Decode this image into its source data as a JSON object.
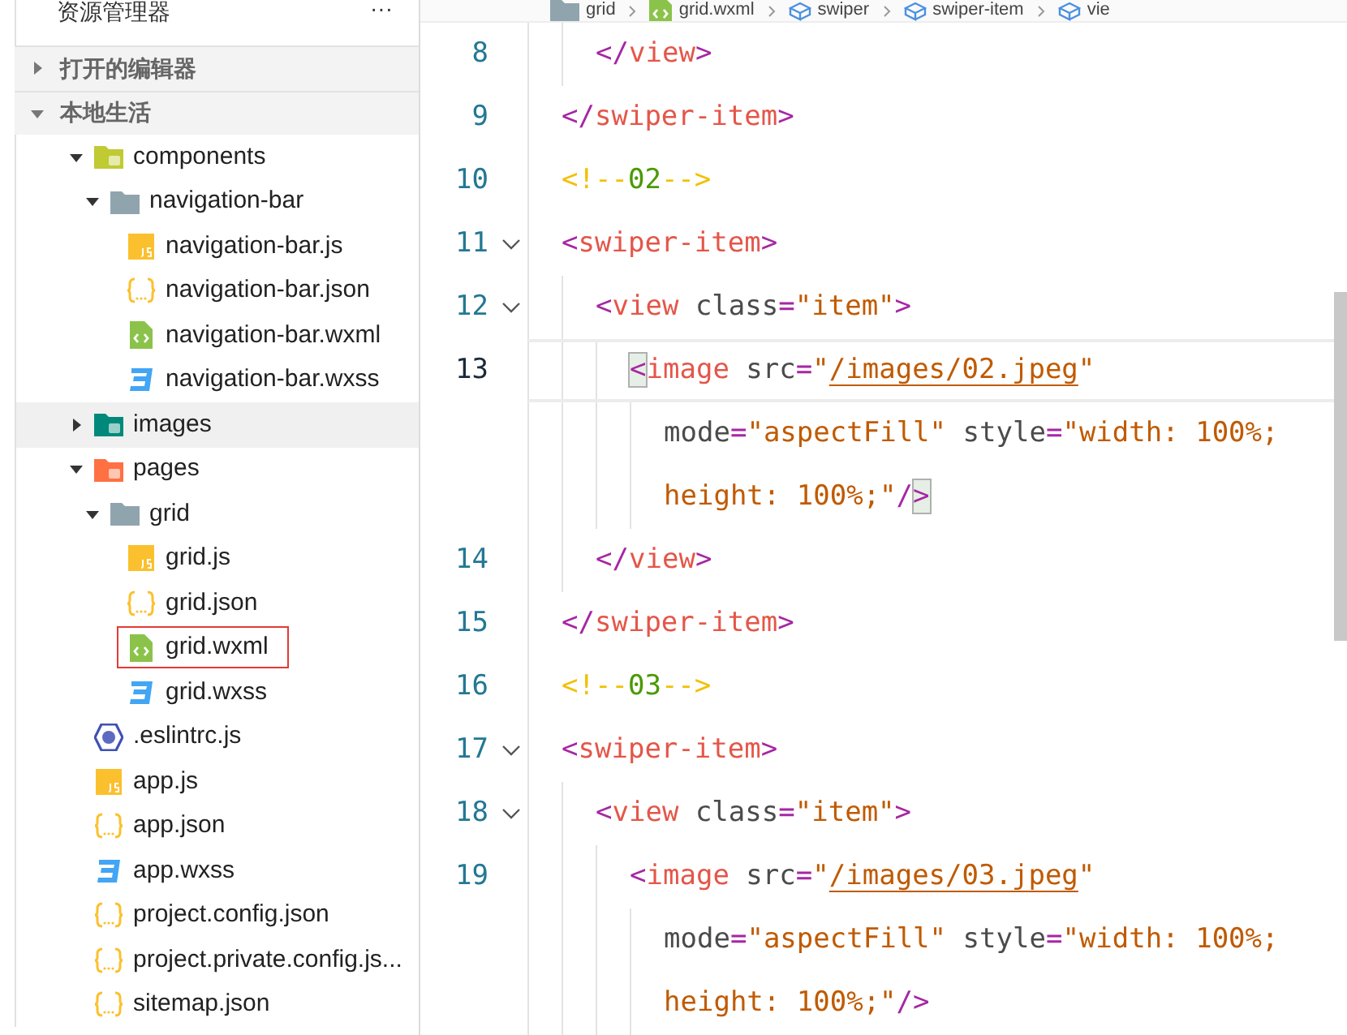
{
  "explorer": {
    "title": "资源管理器",
    "more": "···",
    "sections": [
      {
        "label": "打开的编辑器",
        "expanded": false
      },
      {
        "label": "本地生活",
        "expanded": true
      }
    ],
    "tree": [
      {
        "name": "components",
        "kind": "folder-components",
        "expanded": true,
        "outlined": false,
        "children": [
          {
            "name": "navigation-bar",
            "kind": "folder",
            "expanded": true,
            "outlined": false,
            "children": [
              {
                "name": "navigation-bar.js",
                "kind": "js",
                "outlined": false
              },
              {
                "name": "navigation-bar.json",
                "kind": "json",
                "outlined": false
              },
              {
                "name": "navigation-bar.wxml",
                "kind": "wxml",
                "outlined": false
              },
              {
                "name": "navigation-bar.wxss",
                "kind": "wxss",
                "outlined": false
              }
            ]
          }
        ]
      },
      {
        "name": "images",
        "kind": "folder-images",
        "expanded": false,
        "outlined": false
      },
      {
        "name": "pages",
        "kind": "folder-pages",
        "expanded": true,
        "outlined": false,
        "children": [
          {
            "name": "grid",
            "kind": "folder",
            "expanded": true,
            "outlined": false,
            "children": [
              {
                "name": "grid.js",
                "kind": "js",
                "outlined": false
              },
              {
                "name": "grid.json",
                "kind": "json",
                "outlined": false
              },
              {
                "name": "grid.wxml",
                "kind": "wxml",
                "outlined": true
              },
              {
                "name": "grid.wxss",
                "kind": "wxss",
                "outlined": false
              }
            ]
          }
        ]
      },
      {
        "name": ".eslintrc.js",
        "kind": "eslint",
        "outlined": false
      },
      {
        "name": "app.js",
        "kind": "js",
        "outlined": false
      },
      {
        "name": "app.json",
        "kind": "json",
        "outlined": false
      },
      {
        "name": "app.wxss",
        "kind": "wxss",
        "outlined": false
      },
      {
        "name": "project.config.json",
        "kind": "json",
        "outlined": false
      },
      {
        "name": "project.private.config.js...",
        "kind": "json",
        "outlined": false
      },
      {
        "name": "sitemap.json",
        "kind": "json",
        "outlined": false
      }
    ]
  },
  "breadcrumb": [
    {
      "label": "grid",
      "kind": "folder"
    },
    {
      "label": "grid.wxml",
      "kind": "wxml"
    },
    {
      "label": "swiper",
      "kind": "element"
    },
    {
      "label": "swiper-item",
      "kind": "element"
    },
    {
      "label": "vie",
      "kind": "element"
    }
  ],
  "editor": {
    "lines": [
      {
        "children": [
          {
            "number": "8",
            "fold": false,
            "current": false,
            "segments": [
              {
                "text": "</",
                "kind": "punct"
              },
              {
                "text": "view",
                "kind": "tag"
              },
              {
                "text": ">",
                "kind": "punct"
              }
            ]
          }
        ]
      },
      {
        "number": "9",
        "fold": false,
        "current": false,
        "segments": [
          {
            "text": "</",
            "kind": "punct"
          },
          {
            "text": "swiper-item",
            "kind": "tag"
          },
          {
            "text": ">",
            "kind": "punct"
          }
        ]
      },
      {
        "number": "10",
        "fold": false,
        "current": false,
        "segments": [
          {
            "text": "<!--",
            "kind": "comment-punct"
          },
          {
            "text": "02",
            "kind": "comment"
          },
          {
            "text": "-->",
            "kind": "comment-punct"
          }
        ]
      },
      {
        "number": "11",
        "fold": true,
        "current": false,
        "segments": [
          {
            "text": "<",
            "kind": "punct"
          },
          {
            "text": "swiper-item",
            "kind": "tag"
          },
          {
            "text": ">",
            "kind": "punct"
          }
        ],
        "children": [
          {
            "number": "12",
            "fold": true,
            "current": false,
            "segments": [
              {
                "text": "<",
                "kind": "punct"
              },
              {
                "text": "view",
                "kind": "tag"
              },
              {
                "text": " class",
                "kind": "attr"
              },
              {
                "text": "=",
                "kind": "punct"
              },
              {
                "text": "\"item\"",
                "kind": "string"
              },
              {
                "text": ">",
                "kind": "punct"
              }
            ],
            "children": [
              {
                "number": "13",
                "fold": false,
                "current": true,
                "segments": [
                  {
                    "text": "<",
                    "kind": "bracket-match"
                  },
                  {
                    "text": "image",
                    "kind": "tag"
                  },
                  {
                    "text": " src",
                    "kind": "attr"
                  },
                  {
                    "text": "=",
                    "kind": "punct"
                  },
                  {
                    "text": "\"",
                    "kind": "string"
                  },
                  {
                    "text": "/images/02.jpeg",
                    "kind": "link"
                  },
                  {
                    "text": "\"",
                    "kind": "string"
                  }
                ],
                "wraps": [
                  {
                    "segments": [
                      {
                        "text": "mode",
                        "kind": "attr"
                      },
                      {
                        "text": "=",
                        "kind": "punct"
                      },
                      {
                        "text": "\"aspectFill\"",
                        "kind": "string"
                      },
                      {
                        "text": " style",
                        "kind": "attr"
                      },
                      {
                        "text": "=",
                        "kind": "punct"
                      },
                      {
                        "text": "\"width: 100%;",
                        "kind": "string"
                      }
                    ]
                  },
                  {
                    "segments": [
                      {
                        "text": "height: 100%;\"",
                        "kind": "string"
                      },
                      {
                        "text": "/",
                        "kind": "punct"
                      },
                      {
                        "text": ">",
                        "kind": "bracket-match"
                      }
                    ]
                  }
                ]
              }
            ]
          },
          {
            "number": "14",
            "fold": false,
            "current": false,
            "segments": [
              {
                "text": "</",
                "kind": "punct"
              },
              {
                "text": "view",
                "kind": "tag"
              },
              {
                "text": ">",
                "kind": "punct"
              }
            ]
          }
        ]
      },
      {
        "number": "15",
        "fold": false,
        "current": false,
        "segments": [
          {
            "text": "</",
            "kind": "punct"
          },
          {
            "text": "swiper-item",
            "kind": "tag"
          },
          {
            "text": ">",
            "kind": "punct"
          }
        ]
      },
      {
        "number": "16",
        "fold": false,
        "current": false,
        "segments": [
          {
            "text": "<!--",
            "kind": "comment-punct"
          },
          {
            "text": "03",
            "kind": "comment"
          },
          {
            "text": "-->",
            "kind": "comment-punct"
          }
        ]
      },
      {
        "number": "17",
        "fold": true,
        "current": false,
        "segments": [
          {
            "text": "<",
            "kind": "punct"
          },
          {
            "text": "swiper-item",
            "kind": "tag"
          },
          {
            "text": ">",
            "kind": "punct"
          }
        ],
        "children": [
          {
            "number": "18",
            "fold": true,
            "current": false,
            "segments": [
              {
                "text": "<",
                "kind": "punct"
              },
              {
                "text": "view",
                "kind": "tag"
              },
              {
                "text": " class",
                "kind": "attr"
              },
              {
                "text": "=",
                "kind": "punct"
              },
              {
                "text": "\"item\"",
                "kind": "string"
              },
              {
                "text": ">",
                "kind": "punct"
              }
            ],
            "children": [
              {
                "number": "19",
                "fold": false,
                "current": false,
                "segments": [
                  {
                    "text": "<",
                    "kind": "punct"
                  },
                  {
                    "text": "image",
                    "kind": "tag"
                  },
                  {
                    "text": " src",
                    "kind": "attr"
                  },
                  {
                    "text": "=",
                    "kind": "punct"
                  },
                  {
                    "text": "\"",
                    "kind": "string"
                  },
                  {
                    "text": "/images/03.jpeg",
                    "kind": "link"
                  },
                  {
                    "text": "\"",
                    "kind": "string"
                  }
                ],
                "wraps": [
                  {
                    "segments": [
                      {
                        "text": "mode",
                        "kind": "attr"
                      },
                      {
                        "text": "=",
                        "kind": "punct"
                      },
                      {
                        "text": "\"aspectFill\"",
                        "kind": "string"
                      },
                      {
                        "text": " style",
                        "kind": "attr"
                      },
                      {
                        "text": "=",
                        "kind": "punct"
                      },
                      {
                        "text": "\"width: 100%;",
                        "kind": "string"
                      }
                    ]
                  },
                  {
                    "segments": [
                      {
                        "text": "height: 100%;\"",
                        "kind": "string"
                      },
                      {
                        "text": "/>",
                        "kind": "punct"
                      }
                    ]
                  }
                ]
              }
            ]
          }
        ]
      }
    ]
  }
}
